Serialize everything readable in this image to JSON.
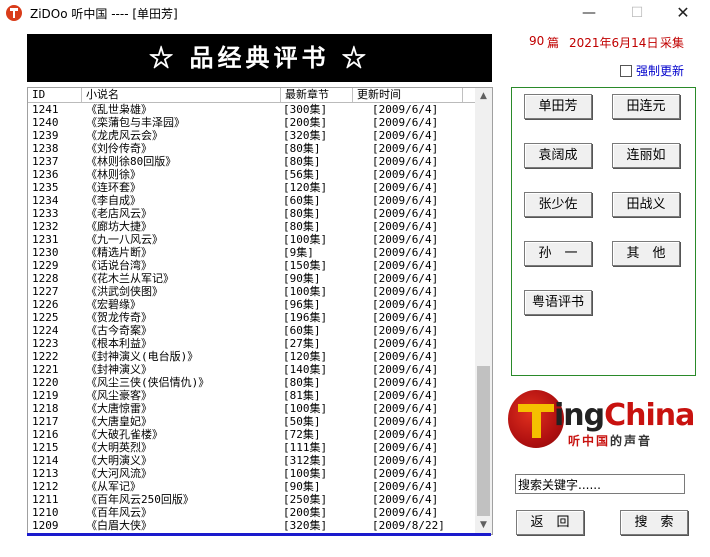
{
  "window": {
    "title": "ZiDOo 听中国 ---- [单田芳]",
    "min_glyph": "—",
    "max_glyph": "☐",
    "close_glyph": "✕"
  },
  "banner": {
    "text": "☆ 品经典评书 ☆"
  },
  "stats": {
    "count": "90",
    "unit": "篇",
    "date": "2021年6月14日",
    "collect": "采集"
  },
  "force_refresh": {
    "label": "强制更新",
    "checked": false
  },
  "table": {
    "headers": {
      "id": "ID",
      "name": "小说名",
      "chapters": "最新章节",
      "time": "更新时间"
    },
    "rows": [
      {
        "id": "1241",
        "name": "《乱世枭雄》",
        "chapters": "[300集]",
        "time": "[2009/6/4]"
      },
      {
        "id": "1240",
        "name": "《栾蒲包与丰泽园》",
        "chapters": "[200集]",
        "time": "[2009/6/4]"
      },
      {
        "id": "1239",
        "name": "《龙虎风云会》",
        "chapters": "[320集]",
        "time": "[2009/6/4]"
      },
      {
        "id": "1238",
        "name": "《刘伶传奇》",
        "chapters": "[80集]",
        "time": "[2009/6/4]"
      },
      {
        "id": "1237",
        "name": "《林则徐80回版》",
        "chapters": "[80集]",
        "time": "[2009/6/4]"
      },
      {
        "id": "1236",
        "name": "《林则徐》",
        "chapters": "[56集]",
        "time": "[2009/6/4]"
      },
      {
        "id": "1235",
        "name": "《连环套》",
        "chapters": "[120集]",
        "time": "[2009/6/4]"
      },
      {
        "id": "1234",
        "name": "《李自成》",
        "chapters": "[60集]",
        "time": "[2009/6/4]"
      },
      {
        "id": "1233",
        "name": "《老店风云》",
        "chapters": "[80集]",
        "time": "[2009/6/4]"
      },
      {
        "id": "1232",
        "name": "《廊坊大捷》",
        "chapters": "[80集]",
        "time": "[2009/6/4]"
      },
      {
        "id": "1231",
        "name": "《九一八风云》",
        "chapters": "[100集]",
        "time": "[2009/6/4]"
      },
      {
        "id": "1230",
        "name": "《精选片断》",
        "chapters": "[9集]",
        "time": "[2009/6/4]"
      },
      {
        "id": "1229",
        "name": "《话说台湾》",
        "chapters": "[150集]",
        "time": "[2009/6/4]"
      },
      {
        "id": "1228",
        "name": "《花木兰从军记》",
        "chapters": "[90集]",
        "time": "[2009/6/4]"
      },
      {
        "id": "1227",
        "name": "《洪武剑侠图》",
        "chapters": "[100集]",
        "time": "[2009/6/4]"
      },
      {
        "id": "1226",
        "name": "《宏碧缘》",
        "chapters": "[96集]",
        "time": "[2009/6/4]"
      },
      {
        "id": "1225",
        "name": "《贺龙传奇》",
        "chapters": "[196集]",
        "time": "[2009/6/4]"
      },
      {
        "id": "1224",
        "name": "《古今奇案》",
        "chapters": "[60集]",
        "time": "[2009/6/4]"
      },
      {
        "id": "1223",
        "name": "《根本利益》",
        "chapters": "[27集]",
        "time": "[2009/6/4]"
      },
      {
        "id": "1222",
        "name": "《封神演义(电台版)》",
        "chapters": "[120集]",
        "time": "[2009/6/4]"
      },
      {
        "id": "1221",
        "name": "《封神演义》",
        "chapters": "[140集]",
        "time": "[2009/6/4]"
      },
      {
        "id": "1220",
        "name": "《风尘三侠(侠侣情仇)》",
        "chapters": "[80集]",
        "time": "[2009/6/4]"
      },
      {
        "id": "1219",
        "name": "《风尘豪客》",
        "chapters": "[81集]",
        "time": "[2009/6/4]"
      },
      {
        "id": "1218",
        "name": "《大唐惊雷》",
        "chapters": "[100集]",
        "time": "[2009/6/4]"
      },
      {
        "id": "1217",
        "name": "《大唐皇妃》",
        "chapters": "[50集]",
        "time": "[2009/6/4]"
      },
      {
        "id": "1216",
        "name": "《大破孔雀楼》",
        "chapters": "[72集]",
        "time": "[2009/6/4]"
      },
      {
        "id": "1215",
        "name": "《大明英烈》",
        "chapters": "[111集]",
        "time": "[2009/6/4]"
      },
      {
        "id": "1214",
        "name": "《大明演义》",
        "chapters": "[312集]",
        "time": "[2009/6/4]"
      },
      {
        "id": "1213",
        "name": "《大河风流》",
        "chapters": "[100集]",
        "time": "[2009/6/4]"
      },
      {
        "id": "1212",
        "name": "《从军记》",
        "chapters": "[90集]",
        "time": "[2009/6/4]"
      },
      {
        "id": "1211",
        "name": "《百年风云250回版》",
        "chapters": "[250集]",
        "time": "[2009/6/4]"
      },
      {
        "id": "1210",
        "name": "《百年风云》",
        "chapters": "[200集]",
        "time": "[2009/6/4]"
      },
      {
        "id": "1209",
        "name": "《白眉大侠》",
        "chapters": "[320集]",
        "time": "[2009/8/22]"
      }
    ]
  },
  "narrators": [
    {
      "label": "单田芳"
    },
    {
      "label": "田连元"
    },
    {
      "label": "袁阔成"
    },
    {
      "label": "连丽如"
    },
    {
      "label": "张少佐"
    },
    {
      "label": "田战义"
    },
    {
      "label": "孙　一"
    },
    {
      "label": "其　他"
    },
    {
      "label": "粤语评书"
    }
  ],
  "logo": {
    "word_black": "ing",
    "word_red": "China",
    "sub_red": "听中国",
    "sub_dark": "的声音"
  },
  "search": {
    "value": "搜索关键字......"
  },
  "buttons": {
    "back": "返　回",
    "search": "搜　索"
  },
  "scrollbar": {
    "up_glyph": "▲",
    "down_glyph": "▼"
  },
  "colors": {
    "banner_bg": "#000000",
    "count_text": "#c00000",
    "link_text": "#0000cc",
    "panel_border": "#2a8a2a",
    "logo_red": "#c8120f"
  }
}
